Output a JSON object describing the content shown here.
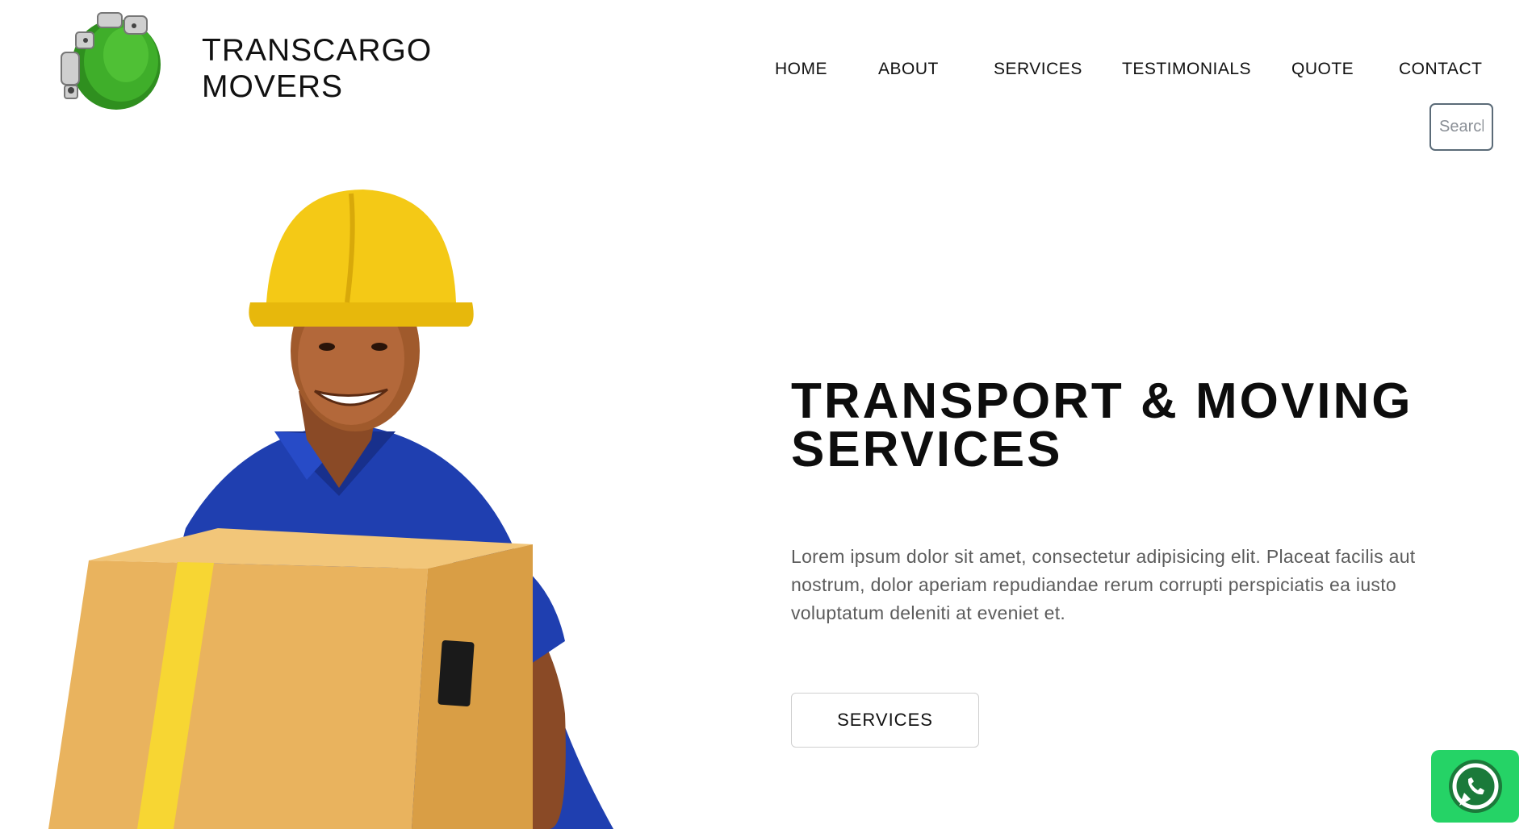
{
  "header": {
    "brand_line1": "TRANSCARGO",
    "brand_line2": "MOVERS"
  },
  "nav": {
    "items": [
      {
        "label": "HOME"
      },
      {
        "label": "ABOUT"
      },
      {
        "label": "SERVICES"
      },
      {
        "label": "TESTIMONIALS"
      },
      {
        "label": "QUOTE"
      },
      {
        "label": "CONTACT"
      }
    ]
  },
  "search": {
    "placeholder": "Search"
  },
  "hero": {
    "title_line1": "TRANSPORT & MOVING",
    "title_line2": "SERVICES",
    "text": "Lorem ipsum dolor sit amet, consectetur adipisicing elit. Placeat facilis aut nostrum, dolor aperiam repudiandae rerum corrupti perspiciatis ea iusto voluptatum deleniti at eveniet et.",
    "button_label": "SERVICES",
    "image_icon": "delivery-worker-illustration"
  },
  "floating": {
    "icon": "whatsapp-icon"
  },
  "colors": {
    "whatsapp_green": "#25d366",
    "helmet_yellow": "#f4c916",
    "shirt_blue": "#1f3fb0",
    "box_tan": "#e9b35e",
    "body_text": "#5c5c5c"
  }
}
